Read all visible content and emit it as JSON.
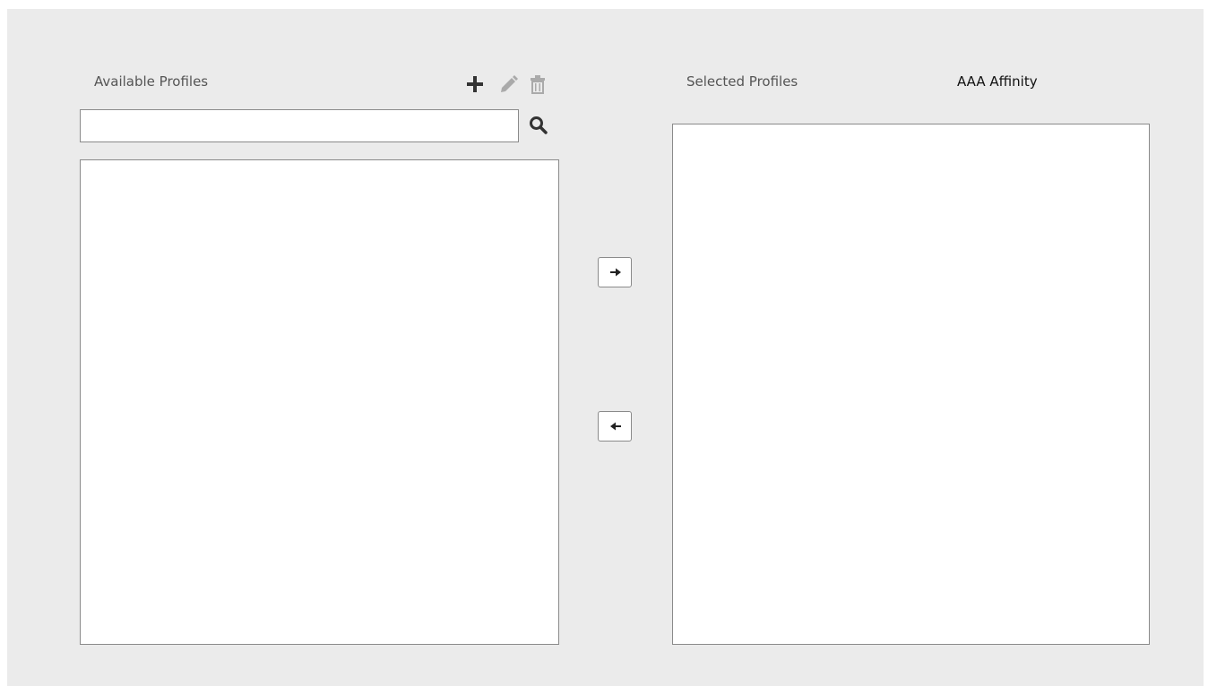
{
  "available": {
    "title": "Available Profiles",
    "search": {
      "value": "",
      "placeholder": ""
    },
    "toolbar": {
      "add_icon": "plus-icon",
      "edit_icon": "pencil-icon",
      "delete_icon": "trash-icon",
      "search_icon": "search-icon"
    },
    "items": []
  },
  "selected": {
    "title": "Selected Profiles",
    "column_header": "AAA Affinity",
    "items": []
  },
  "transfer": {
    "add_icon": "arrow-right-icon",
    "remove_icon": "arrow-left-icon"
  },
  "colors": {
    "background": "#ebebeb",
    "border": "#8a8a8a",
    "icon_active": "#333333",
    "icon_disabled": "#aaaaaa"
  }
}
